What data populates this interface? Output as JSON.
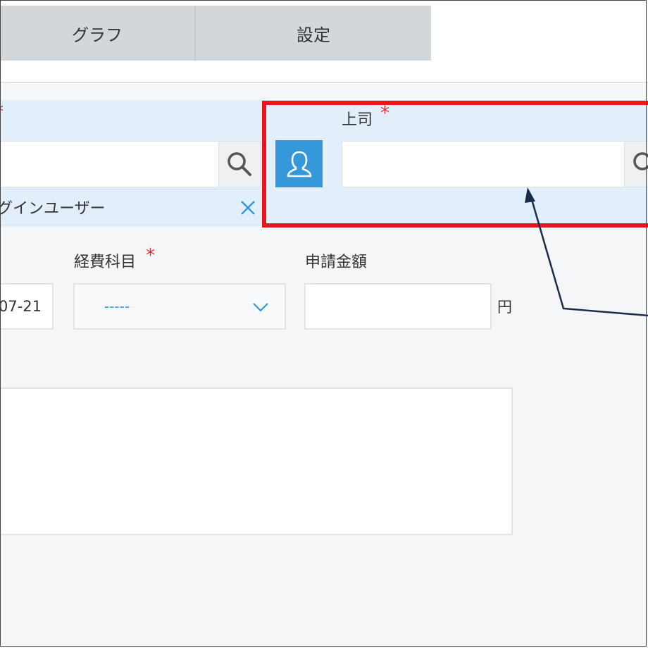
{
  "tabs": [
    {
      "label": "グラフ"
    },
    {
      "label": "設定"
    }
  ],
  "applicant_field": {
    "required_mark": "*",
    "search_value": "",
    "selected_user": "グインユーザー"
  },
  "boss_field": {
    "label": "上司",
    "required_mark": "*",
    "value": ""
  },
  "date_field": {
    "value": "07-21"
  },
  "expense_field": {
    "label": "経費科目",
    "required_mark": "*",
    "selected": "-----"
  },
  "amount_field": {
    "label": "申請金額",
    "value": "",
    "unit": "円"
  },
  "notes_field": {
    "value": ""
  },
  "colors": {
    "accent": "#3498db",
    "highlight": "#e8141e",
    "required": "#e03333",
    "field_bg": "#e2effb"
  }
}
